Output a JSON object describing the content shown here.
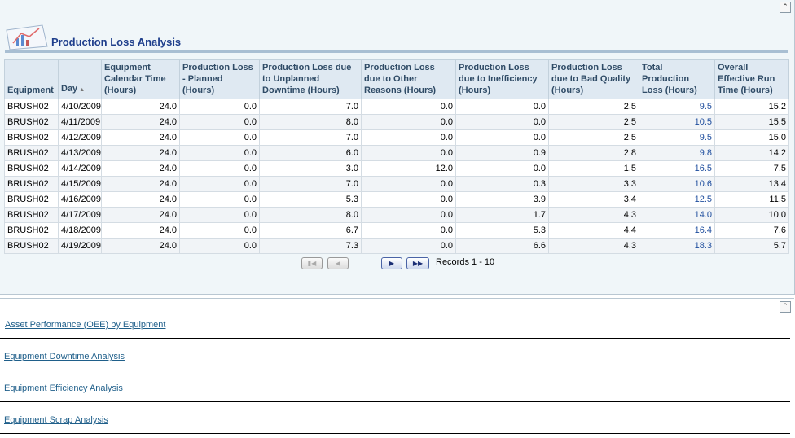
{
  "report": {
    "title": "Production Loss Analysis",
    "icon": "chart-report-icon"
  },
  "table": {
    "columns": [
      "Equipment",
      "Day",
      "Equipment Calendar Time (Hours)",
      "Production Loss - Planned (Hours)",
      "Production Loss due to Unplanned Downtime (Hours)",
      "Production Loss due to Other Reasons (Hours)",
      "Production Loss due to Inefficiency (Hours)",
      "Production Loss due to Bad Quality (Hours)",
      "Total Production Loss (Hours)",
      "Overall Effective Run Time (Hours)"
    ],
    "rows": [
      [
        "BRUSH02",
        "4/10/2009",
        "24.0",
        "0.0",
        "7.0",
        "0.0",
        "0.0",
        "2.5",
        "9.5",
        "15.2"
      ],
      [
        "BRUSH02",
        "4/11/2009",
        "24.0",
        "0.0",
        "8.0",
        "0.0",
        "0.0",
        "2.5",
        "10.5",
        "15.5"
      ],
      [
        "BRUSH02",
        "4/12/2009",
        "24.0",
        "0.0",
        "7.0",
        "0.0",
        "0.0",
        "2.5",
        "9.5",
        "15.0"
      ],
      [
        "BRUSH02",
        "4/13/2009",
        "24.0",
        "0.0",
        "6.0",
        "0.0",
        "0.9",
        "2.8",
        "9.8",
        "14.2"
      ],
      [
        "BRUSH02",
        "4/14/2009",
        "24.0",
        "0.0",
        "3.0",
        "12.0",
        "0.0",
        "1.5",
        "16.5",
        "7.5"
      ],
      [
        "BRUSH02",
        "4/15/2009",
        "24.0",
        "0.0",
        "7.0",
        "0.0",
        "0.3",
        "3.3",
        "10.6",
        "13.4"
      ],
      [
        "BRUSH02",
        "4/16/2009",
        "24.0",
        "0.0",
        "5.3",
        "0.0",
        "3.9",
        "3.4",
        "12.5",
        "11.5"
      ],
      [
        "BRUSH02",
        "4/17/2009",
        "24.0",
        "0.0",
        "8.0",
        "0.0",
        "1.7",
        "4.3",
        "14.0",
        "10.0"
      ],
      [
        "BRUSH02",
        "4/18/2009",
        "24.0",
        "0.0",
        "6.7",
        "0.0",
        "5.3",
        "4.4",
        "16.4",
        "7.6"
      ],
      [
        "BRUSH02",
        "4/19/2009",
        "24.0",
        "0.0",
        "7.3",
        "0.0",
        "6.6",
        "4.3",
        "18.3",
        "5.7"
      ]
    ]
  },
  "pager": {
    "records_label": "Records 1 - 10",
    "first_icon": "first-page-icon",
    "prev_icon": "prev-page-icon",
    "next_icon": "next-page-icon",
    "last_icon": "last-page-icon"
  },
  "links": [
    "Asset Performance (OEE) by Equipment",
    "Equipment Downtime Analysis",
    "Equipment Efficiency Analysis",
    "Equipment Scrap Analysis"
  ],
  "colors": {
    "title": "#1f3f8c",
    "header_bg": "#dfe9f2",
    "link": "#1f5f8a",
    "value_link": "#1f4e9e"
  }
}
